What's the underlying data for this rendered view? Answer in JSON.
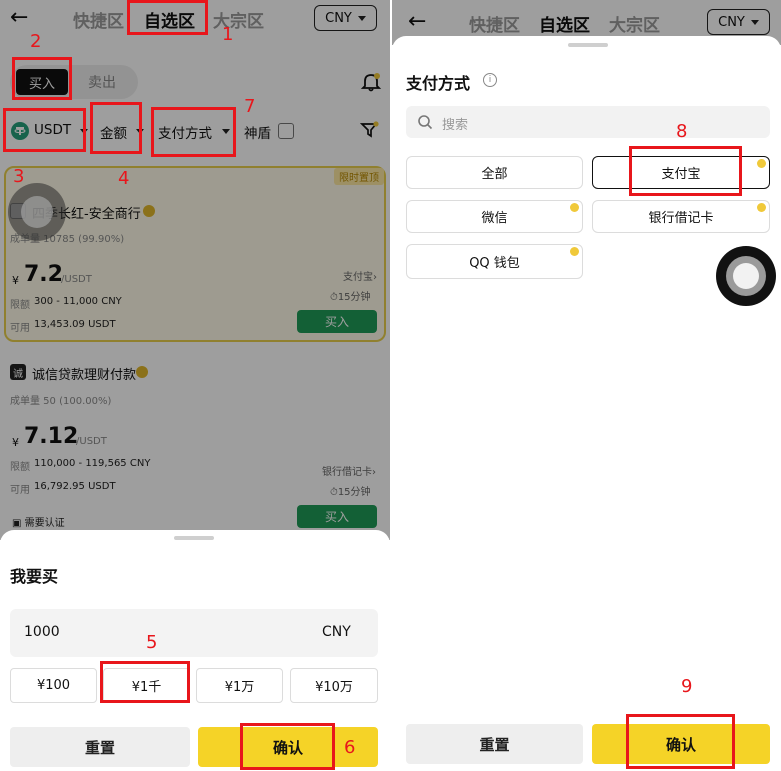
{
  "left": {
    "header": {
      "back_icon": "←",
      "tabs": [
        {
          "label": "快捷区"
        },
        {
          "label": "自选区"
        },
        {
          "label": "大宗区"
        }
      ],
      "currency": "CNY"
    },
    "trade_toggle": {
      "buy": "买入",
      "sell": "卖出"
    },
    "filters": {
      "coin": "USDT",
      "amount": "金额",
      "payment": "支付方式",
      "shield": "神盾"
    },
    "listings": [
      {
        "badge": "限时置顶",
        "merchant": "四季长红-安全商行",
        "stats": "成单量 10785 (99.90%)",
        "currency_symbol": "¥",
        "price": "7.2",
        "price_unit": "/USDT",
        "limit_label": "限额",
        "limit": "300 - 11,000 CNY",
        "available_label": "可用",
        "available": "13,453.09 USDT",
        "method": "支付宝",
        "method_arrow": "›",
        "time": "15分钟",
        "action": "买入"
      },
      {
        "badge": "",
        "avatar_char": "诚",
        "merchant": "诚信贷款理财付款",
        "stats": "成单量 50 (100.00%)",
        "currency_symbol": "¥",
        "price": "7.12",
        "price_unit": "/USDT",
        "limit_label": "限额",
        "limit": "110,000 - 119,565 CNY",
        "available_label": "可用",
        "available": "16,792.95 USDT",
        "method": "银行借记卡",
        "method_arrow": "›",
        "time": "15分钟",
        "action": "买入",
        "verify": "需要认证"
      }
    ],
    "sheet": {
      "title": "我要买",
      "amount_value": "1000",
      "amount_currency": "CNY",
      "chips": [
        "¥100",
        "¥1千",
        "¥1万",
        "¥10万"
      ],
      "reset": "重置",
      "confirm": "确认"
    },
    "annotations": [
      "1",
      "2",
      "3",
      "4",
      "5",
      "6",
      "7"
    ]
  },
  "right": {
    "header": {
      "back_icon": "←",
      "tabs": [
        {
          "label": "快捷区"
        },
        {
          "label": "自选区"
        },
        {
          "label": "大宗区"
        }
      ],
      "currency": "CNY"
    },
    "sheet": {
      "title": "支付方式",
      "info_icon": "i",
      "search_placeholder": "搜索",
      "options": [
        "全部",
        "支付宝",
        "微信",
        "银行借记卡",
        "QQ 钱包"
      ],
      "reset": "重置",
      "confirm": "确认"
    },
    "annotations": [
      "8",
      "9"
    ]
  },
  "colors": {
    "annotation_red": "#e8161b",
    "confirm_yellow": "#f5d327",
    "buy_green": "#1f9c57",
    "overlay": "rgba(0,0,0,0.38)"
  }
}
